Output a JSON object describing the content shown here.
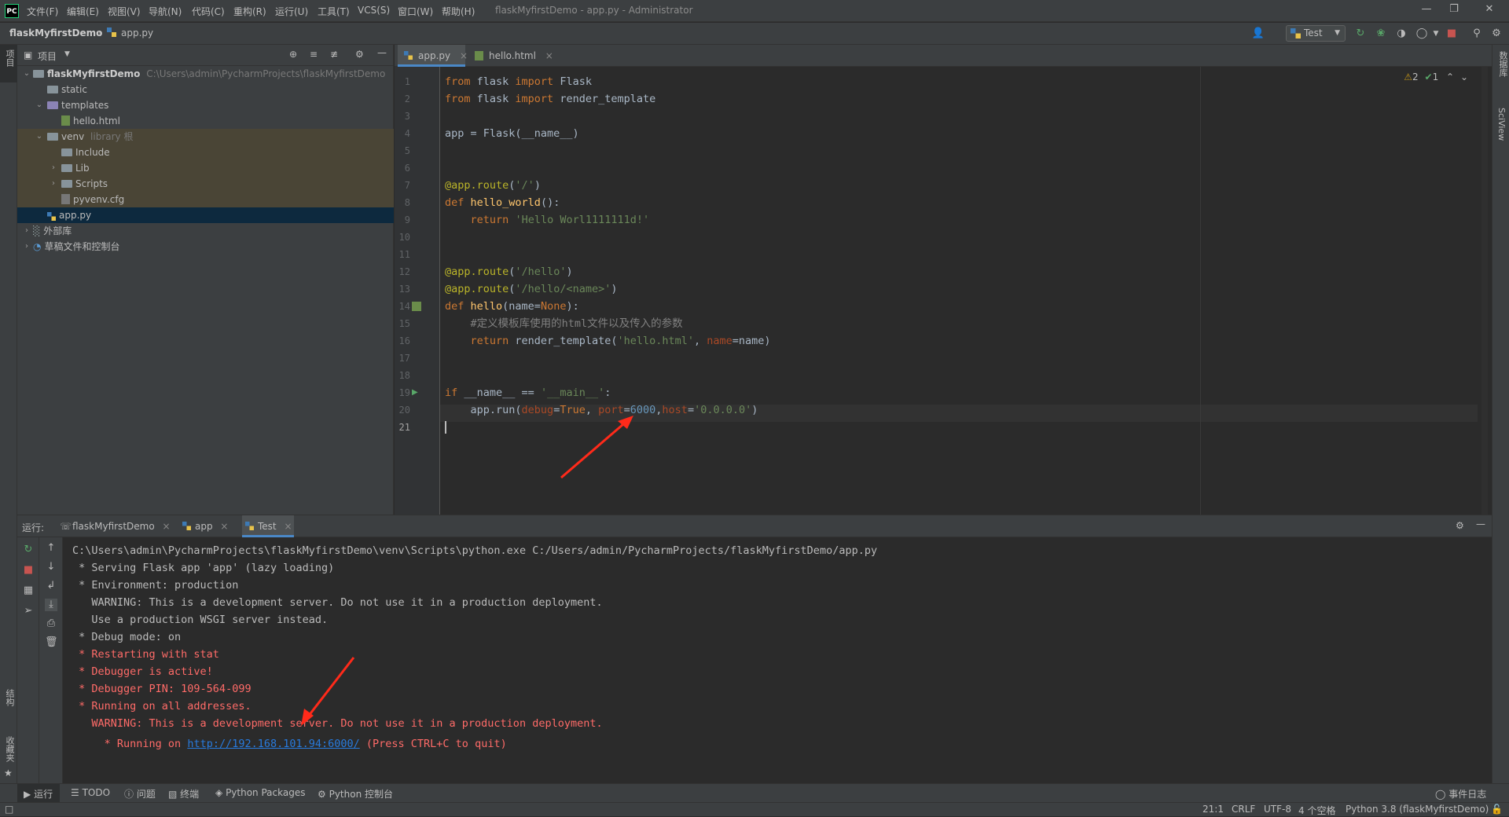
{
  "titlebar": {
    "logo": "PC",
    "menus": [
      "文件(F)",
      "编辑(E)",
      "视图(V)",
      "导航(N)",
      "代码(C)",
      "重构(R)",
      "运行(U)",
      "工具(T)",
      "VCS(S)",
      "窗口(W)",
      "帮助(H)"
    ],
    "window_title": "flaskMyfirstDemo - app.py - Administrator"
  },
  "navbar": {
    "project": "flaskMyfirstDemo",
    "file": "app.py",
    "run_config": "Test"
  },
  "project_panel": {
    "title": "项目",
    "root": {
      "name": "flaskMyfirstDemo",
      "path": "C:\\Users\\admin\\PycharmProjects\\flaskMyfirstDemo"
    },
    "items": [
      {
        "label": "static"
      },
      {
        "label": "templates"
      },
      {
        "label": "hello.html"
      },
      {
        "label": "venv",
        "hint": "library 根"
      },
      {
        "label": "Include"
      },
      {
        "label": "Lib"
      },
      {
        "label": "Scripts"
      },
      {
        "label": "pyvenv.cfg"
      },
      {
        "label": "app.py"
      },
      {
        "label": "外部库"
      },
      {
        "label": "草稿文件和控制台"
      }
    ]
  },
  "left_tool": {
    "project": "项目",
    "structure": "结构",
    "favorites": "收藏夹"
  },
  "right_tool": {
    "database": "数据库",
    "sciview": "SciView"
  },
  "editor": {
    "tabs": [
      {
        "label": "app.py"
      },
      {
        "label": "hello.html"
      }
    ],
    "warnings": "2",
    "checks": "1",
    "line_numbers": [
      "1",
      "2",
      "3",
      "4",
      "5",
      "6",
      "7",
      "8",
      "9",
      "10",
      "11",
      "12",
      "13",
      "14",
      "15",
      "16",
      "17",
      "18",
      "19",
      "20",
      "21"
    ]
  },
  "run_panel": {
    "label": "运行:",
    "tabs": [
      {
        "label": "flaskMyfirstDemo"
      },
      {
        "label": "app"
      },
      {
        "label": "Test"
      }
    ],
    "output": [
      {
        "text": "C:\\Users\\admin\\PycharmProjects\\flaskMyfirstDemo\\venv\\Scripts\\python.exe C:/Users/admin/PycharmProjects/flaskMyfirstDemo/app.py",
        "style": "white"
      },
      {
        "text": " * Serving Flask app 'app' (lazy loading)",
        "style": "white"
      },
      {
        "text": " * Environment: production",
        "style": "white"
      },
      {
        "text": "   WARNING: This is a development server. Do not use it in a production deployment.",
        "style": "white"
      },
      {
        "text": "   Use a production WSGI server instead.",
        "style": "white"
      },
      {
        "text": " * Debug mode: on",
        "style": "white"
      },
      {
        "text": " * Restarting with stat",
        "style": "red"
      },
      {
        "text": " * Debugger is active!",
        "style": "red"
      },
      {
        "text": " * Debugger PIN: 109-564-099",
        "style": "red"
      },
      {
        "text": " * Running on all addresses.",
        "style": "red"
      },
      {
        "text": "   WARNING: This is a development server. Do not use it in a production deployment.",
        "style": "red"
      }
    ],
    "last_line": {
      "prefix": " * Running on ",
      "link": "http://192.168.101.94:6000/",
      "suffix": " (Press CTRL+C to quit)"
    }
  },
  "bottom_tabs": [
    "运行",
    "TODO",
    "问题",
    "终端",
    "Python Packages",
    "Python 控制台"
  ],
  "event_log": "事件日志",
  "status": {
    "position": "21:1",
    "line_sep": "CRLF",
    "encoding": "UTF-8",
    "indent": "4 个空格",
    "interpreter": "Python 3.8 (flaskMyfirstDemo)"
  }
}
